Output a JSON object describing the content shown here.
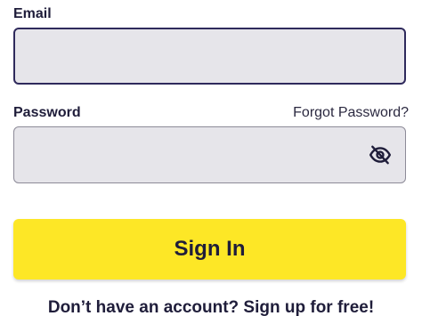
{
  "form": {
    "email": {
      "label": "Email",
      "value": "",
      "placeholder": ""
    },
    "password": {
      "label": "Password",
      "forgot_label": "Forgot Password?",
      "value": "",
      "placeholder": "",
      "toggle_icon": "eye-off-icon"
    },
    "signin_label": "Sign In",
    "signup_text": "Don’t have an account? Sign up for free!"
  },
  "colors": {
    "accent": "#fde726",
    "text": "#1f1d3a",
    "field_bg": "#e6e5ea",
    "focus_border": "#2f2a5c"
  }
}
